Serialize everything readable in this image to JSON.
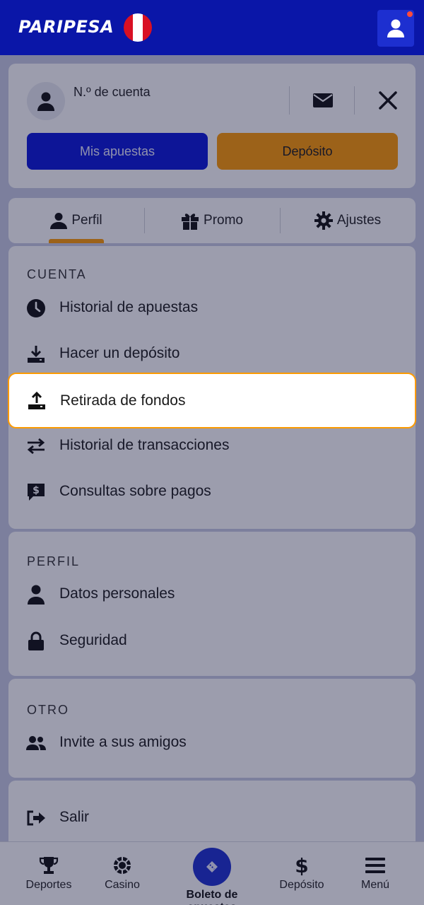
{
  "header": {
    "logo": "PARIPESA",
    "flag_colors": [
      "#d91023",
      "#ffffff",
      "#d91023"
    ]
  },
  "account": {
    "label": "N.º de cuenta",
    "bets_button": "Mis apuestas",
    "deposit_button": "Depósito"
  },
  "tabs": [
    {
      "label": "Perfil",
      "icon": "person-icon",
      "active": true
    },
    {
      "label": "Promo",
      "icon": "gift-icon",
      "active": false
    },
    {
      "label": "Ajustes",
      "icon": "gear-icon",
      "active": false
    }
  ],
  "sections": {
    "cuenta": {
      "title": "CUENTA",
      "items": [
        {
          "label": "Historial de apuestas",
          "icon": "clock-icon"
        },
        {
          "label": "Hacer un depósito",
          "icon": "download-tray-icon"
        },
        {
          "label": "Retirada de fondos",
          "icon": "upload-tray-icon",
          "highlighted": true
        },
        {
          "label": "Historial de transacciones",
          "icon": "swap-arrows-icon"
        },
        {
          "label": "Consultas sobre pagos",
          "icon": "dollar-chat-icon"
        }
      ]
    },
    "perfil": {
      "title": "PERFIL",
      "items": [
        {
          "label": "Datos personales",
          "icon": "person-icon"
        },
        {
          "label": "Seguridad",
          "icon": "lock-icon"
        }
      ]
    },
    "otro": {
      "title": "OTRO",
      "items": [
        {
          "label": "Invite a sus amigos",
          "icon": "people-icon"
        }
      ]
    },
    "salir": {
      "label": "Salir",
      "icon": "logout-icon"
    }
  },
  "bottom_nav": [
    {
      "label": "Deportes",
      "icon": "trophy-icon"
    },
    {
      "label": "Casino",
      "icon": "casino-chip-icon"
    },
    {
      "label": "Boleto de apuestas",
      "icon": "ticket-icon"
    },
    {
      "label": "Depósito",
      "icon": "dollar-icon"
    },
    {
      "label": "Menú",
      "icon": "hamburger-icon"
    }
  ],
  "colors": {
    "brand_blue": "#0a16a8",
    "accent_orange": "#ff9a00",
    "notification": "#ff4b3a"
  }
}
